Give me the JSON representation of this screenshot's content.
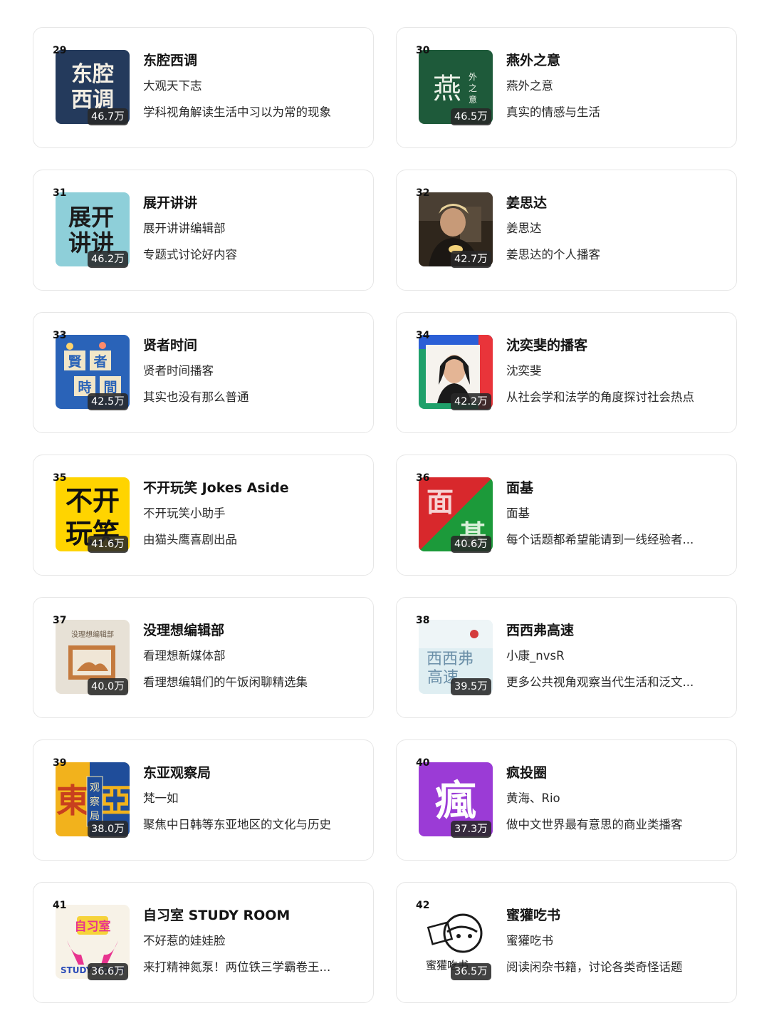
{
  "podcasts": [
    {
      "rank": "29",
      "title": "东腔西调",
      "author": "大观天下志",
      "description": "学科视角解读生活中习以为常的现象",
      "subscribers": "46.7万",
      "cover_text": "东腔\n西调",
      "cover_color": "#243a5c"
    },
    {
      "rank": "30",
      "title": "燕外之意",
      "author": "燕外之意",
      "description": "真实的情感与生活",
      "subscribers": "46.5万",
      "cover_text": "燕 外之意",
      "cover_color": "#1e5a3a"
    },
    {
      "rank": "31",
      "title": "展开讲讲",
      "author": "展开讲讲编辑部",
      "description": "专题式讨论好内容",
      "subscribers": "46.2万",
      "cover_text": "展开\n讲讲",
      "cover_color": "#8ecfd9"
    },
    {
      "rank": "32",
      "title": "姜思达",
      "author": "姜思达",
      "description": "姜思达的个人播客",
      "subscribers": "42.7万",
      "cover_color": "#3a2e22"
    },
    {
      "rank": "33",
      "title": "贤者时间",
      "author": "贤者时间播客",
      "description": "其实也没有那么普通",
      "subscribers": "42.5万",
      "cover_text": "賢 者 時 間",
      "cover_color": "#2a63b8"
    },
    {
      "rank": "34",
      "title": "沈奕斐的播客",
      "author": "沈奕斐",
      "description": "从社会学和法学的角度探讨社会热点",
      "subscribers": "42.2万",
      "cover_color": "#1fa06a"
    },
    {
      "rank": "35",
      "title": "不开玩笑 Jokes Aside",
      "author": "不开玩笑小助手",
      "description": "由猫头鹰喜剧出品",
      "subscribers": "41.6万",
      "cover_text": "不开\n玩笑",
      "cover_color": "#ffd400"
    },
    {
      "rank": "36",
      "title": "面基",
      "author": "面基",
      "description": "每个话题都希望能请到一线经验者...",
      "subscribers": "40.6万",
      "cover_text": "面 基",
      "cover_color": "#d8282c"
    },
    {
      "rank": "37",
      "title": "没理想编辑部",
      "author": "看理想新媒体部",
      "description": "看理想编辑们的午饭闲聊精选集",
      "subscribers": "40.0万",
      "cover_text": "没理想编辑部",
      "cover_color": "#e7e1d6"
    },
    {
      "rank": "38",
      "title": "西西弗高速",
      "author": "小康_nvsR",
      "description": "更多公共视角观察当代生活和泛文...",
      "subscribers": "39.5万",
      "cover_text": "西西弗\n高速",
      "cover_color": "#dfeef2"
    },
    {
      "rank": "39",
      "title": "东亚观察局",
      "author": "梵一如",
      "description": "聚焦中日韩等东亚地区的文化与历史",
      "subscribers": "38.0万",
      "cover_text": "東亞 观察局",
      "cover_color": "#f2b21c"
    },
    {
      "rank": "40",
      "title": "疯投圈",
      "author": "黄海、Rio",
      "description": "做中文世界最有意思的商业类播客",
      "subscribers": "37.3万",
      "cover_text": "瘋",
      "cover_color": "#9b3bd6"
    },
    {
      "rank": "41",
      "title": "自习室 STUDY ROOM",
      "author": "不好惹的娃娃脸",
      "description": "来打精神氮泵！两位铁三学霸卷王...",
      "subscribers": "36.6万",
      "cover_text": "自习室 STUDY ROOM",
      "cover_color": "#e8348f"
    },
    {
      "rank": "42",
      "title": "蜜獾吃书",
      "author": "蜜獾吃书",
      "description": "阅读闲杂书籍，讨论各类奇怪话题",
      "subscribers": "36.5万",
      "cover_text": "蜜獾吃书",
      "cover_color": "#ffffff"
    }
  ]
}
